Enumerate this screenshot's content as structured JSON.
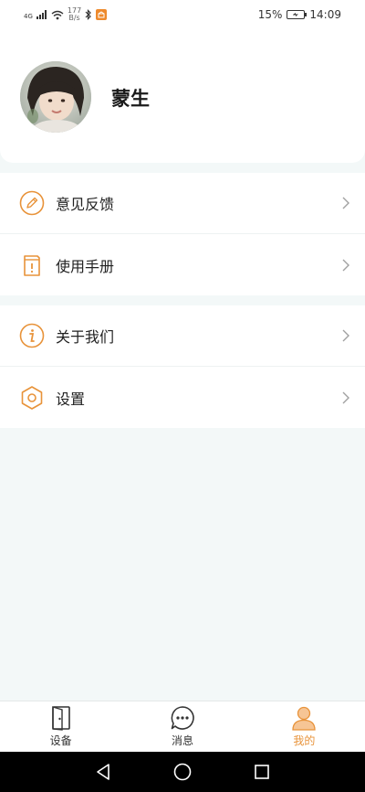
{
  "status_bar": {
    "network_type": "4G",
    "net_speed_value": "177",
    "net_speed_unit": "B/s",
    "battery_percent": "15%",
    "time": "14:09"
  },
  "profile": {
    "name": "蒙生"
  },
  "menu_groups": [
    {
      "items": [
        {
          "label": "意见反馈",
          "icon": "edit-pencil-icon"
        },
        {
          "label": "使用手册",
          "icon": "manual-book-icon"
        }
      ]
    },
    {
      "items": [
        {
          "label": "关于我们",
          "icon": "info-icon"
        },
        {
          "label": "设置",
          "icon": "settings-hexagon-icon"
        }
      ]
    }
  ],
  "tab_bar": {
    "tabs": [
      {
        "label": "设备",
        "icon": "door-device-icon",
        "active": false
      },
      {
        "label": "消息",
        "icon": "message-bubble-icon",
        "active": false
      },
      {
        "label": "我的",
        "icon": "person-icon",
        "active": true
      }
    ]
  },
  "colors": {
    "accent": "#e8933a",
    "background": "#f3f8f8"
  }
}
